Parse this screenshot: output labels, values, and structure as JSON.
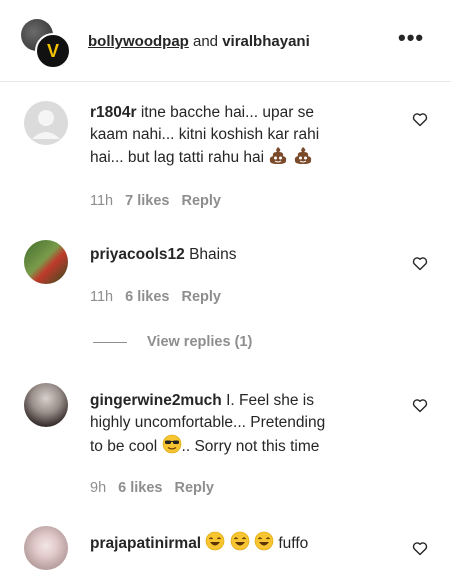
{
  "header": {
    "user1": "bollywoodpap",
    "conj": " and ",
    "user2": "viralbhayani",
    "avatar_letter": "V",
    "more_label": "•••"
  },
  "comments": [
    {
      "username": "r1804r",
      "lines": [
        "itne bacche hai... upar se",
        "kaam nahi... kitni koshish kar rahi",
        "hai... but lag tatti rahu hai"
      ],
      "time": "11h",
      "likes": "7 likes",
      "reply": "Reply",
      "trailing_emoji": "poo-emoji"
    },
    {
      "username": "priyacools12",
      "lines": [
        "Bhains"
      ],
      "time": "11h",
      "likes": "6 likes",
      "reply": "Reply"
    },
    {
      "username": "gingerwine2much",
      "lines": [
        "I. Feel she is",
        "highly uncomfortable... Pretending",
        "to be cool",
        ".. Sorry not this time"
      ],
      "time": "9h",
      "likes": "6 likes",
      "reply": "Reply",
      "inline_emoji": "sunglasses-emoji"
    },
    {
      "username": "prajapatinirmal",
      "lines": [
        "fuffo"
      ],
      "inline_emoji": "laughing-emoji"
    }
  ],
  "view_replies": "View replies (1)",
  "colors": {
    "text": "#262626",
    "meta": "#8e8e8e",
    "divider": "#e6e6e6"
  }
}
